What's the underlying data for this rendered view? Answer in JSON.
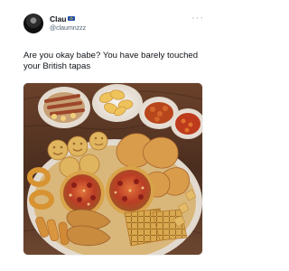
{
  "tweet": {
    "author_name": "Clau",
    "author_handle": "@claumnzzz",
    "text": "Are you okay babe? You have barely touched your British tapas",
    "more_icon": "more-horizontal-icon",
    "flag_icon": "eu-flag-icon",
    "avatar_icon": "profile-avatar"
  },
  "colors": {
    "text_primary": "#0f1419",
    "text_secondary": "#536471",
    "table_wood": "#5b3925",
    "plate_white": "#f5f1e8"
  }
}
